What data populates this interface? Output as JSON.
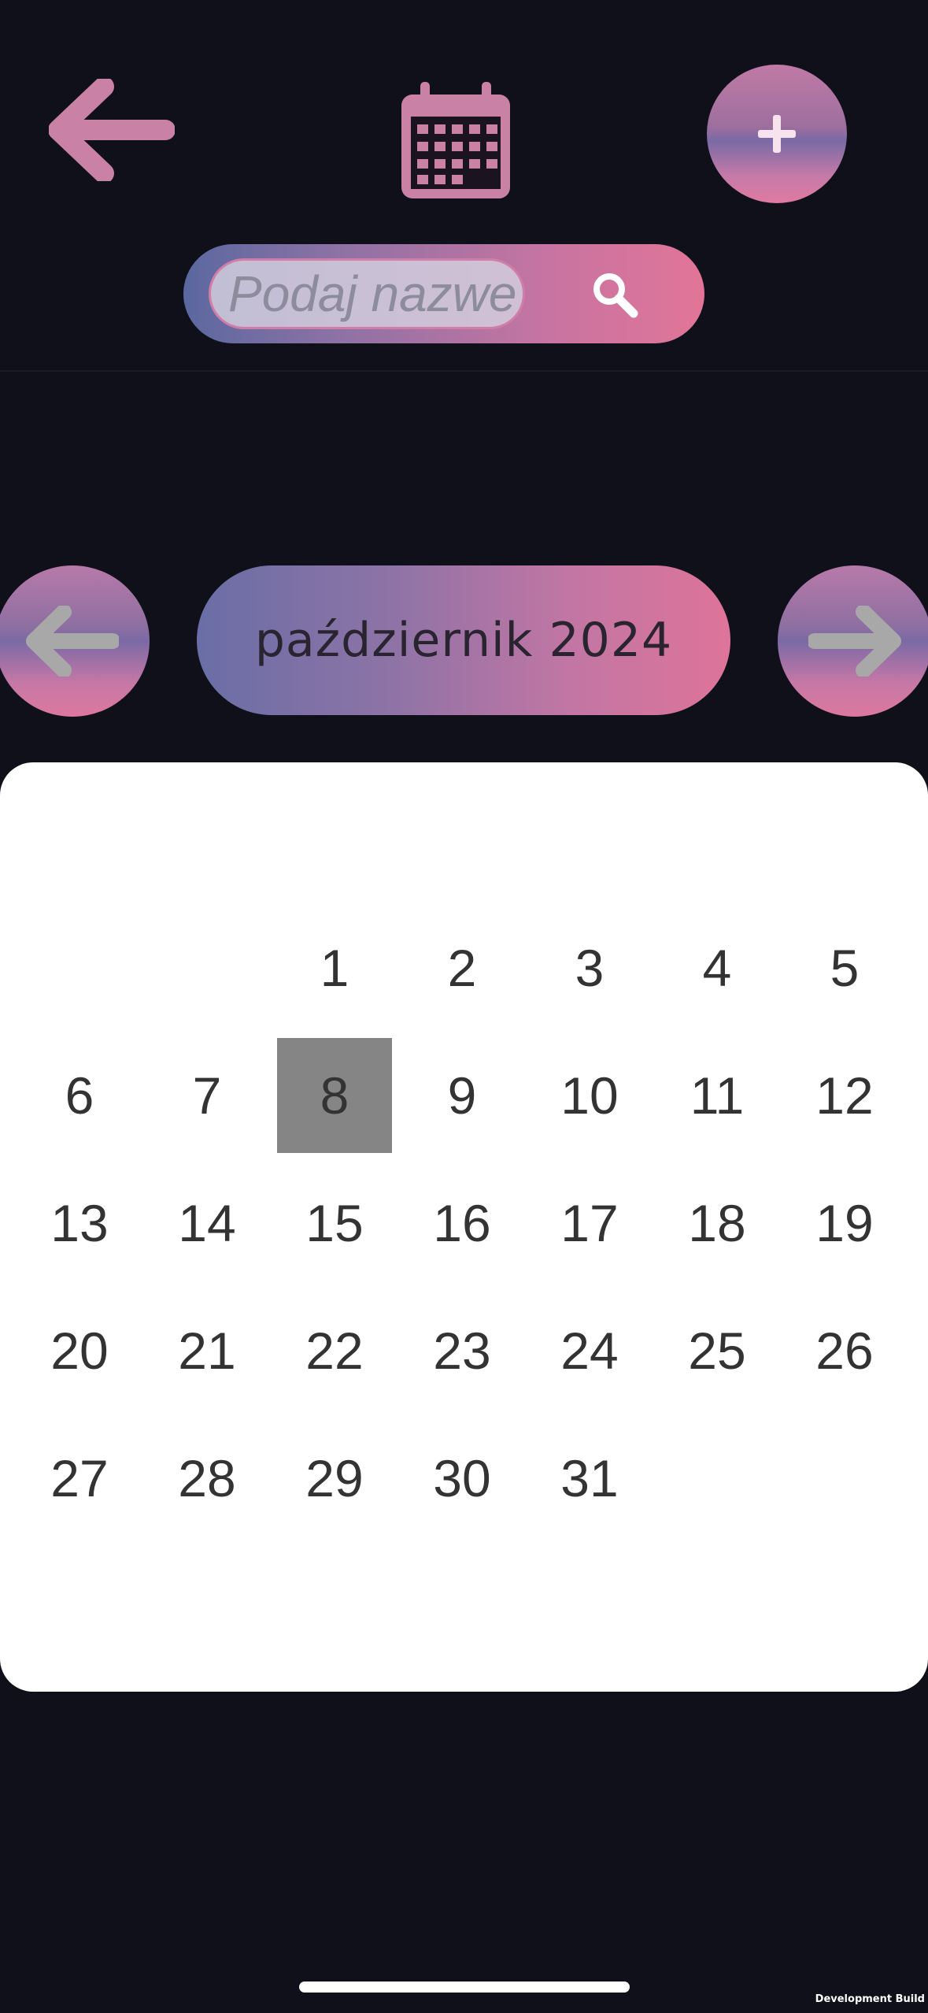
{
  "header": {
    "back_icon": "arrow-left-icon",
    "calendar_icon": "calendar-icon",
    "add_icon": "plus-icon",
    "search": {
      "placeholder": "Podaj nazwe",
      "icon": "search-icon"
    }
  },
  "month_nav": {
    "prev_icon": "arrow-left-icon",
    "next_icon": "arrow-right-icon",
    "label": "październik 2024"
  },
  "calendar": {
    "leading_blank_days": 2,
    "days": [
      "1",
      "2",
      "3",
      "4",
      "5",
      "6",
      "7",
      "8",
      "9",
      "10",
      "11",
      "12",
      "13",
      "14",
      "15",
      "16",
      "17",
      "18",
      "19",
      "20",
      "21",
      "22",
      "23",
      "24",
      "25",
      "26",
      "27",
      "28",
      "29",
      "30",
      "31"
    ],
    "selected_day": "8"
  },
  "footer": {
    "dev_build_label": "Development Build"
  },
  "colors": {
    "background": "#10101b",
    "accent_pink": "#c982a6",
    "selected_day": "#858585"
  }
}
